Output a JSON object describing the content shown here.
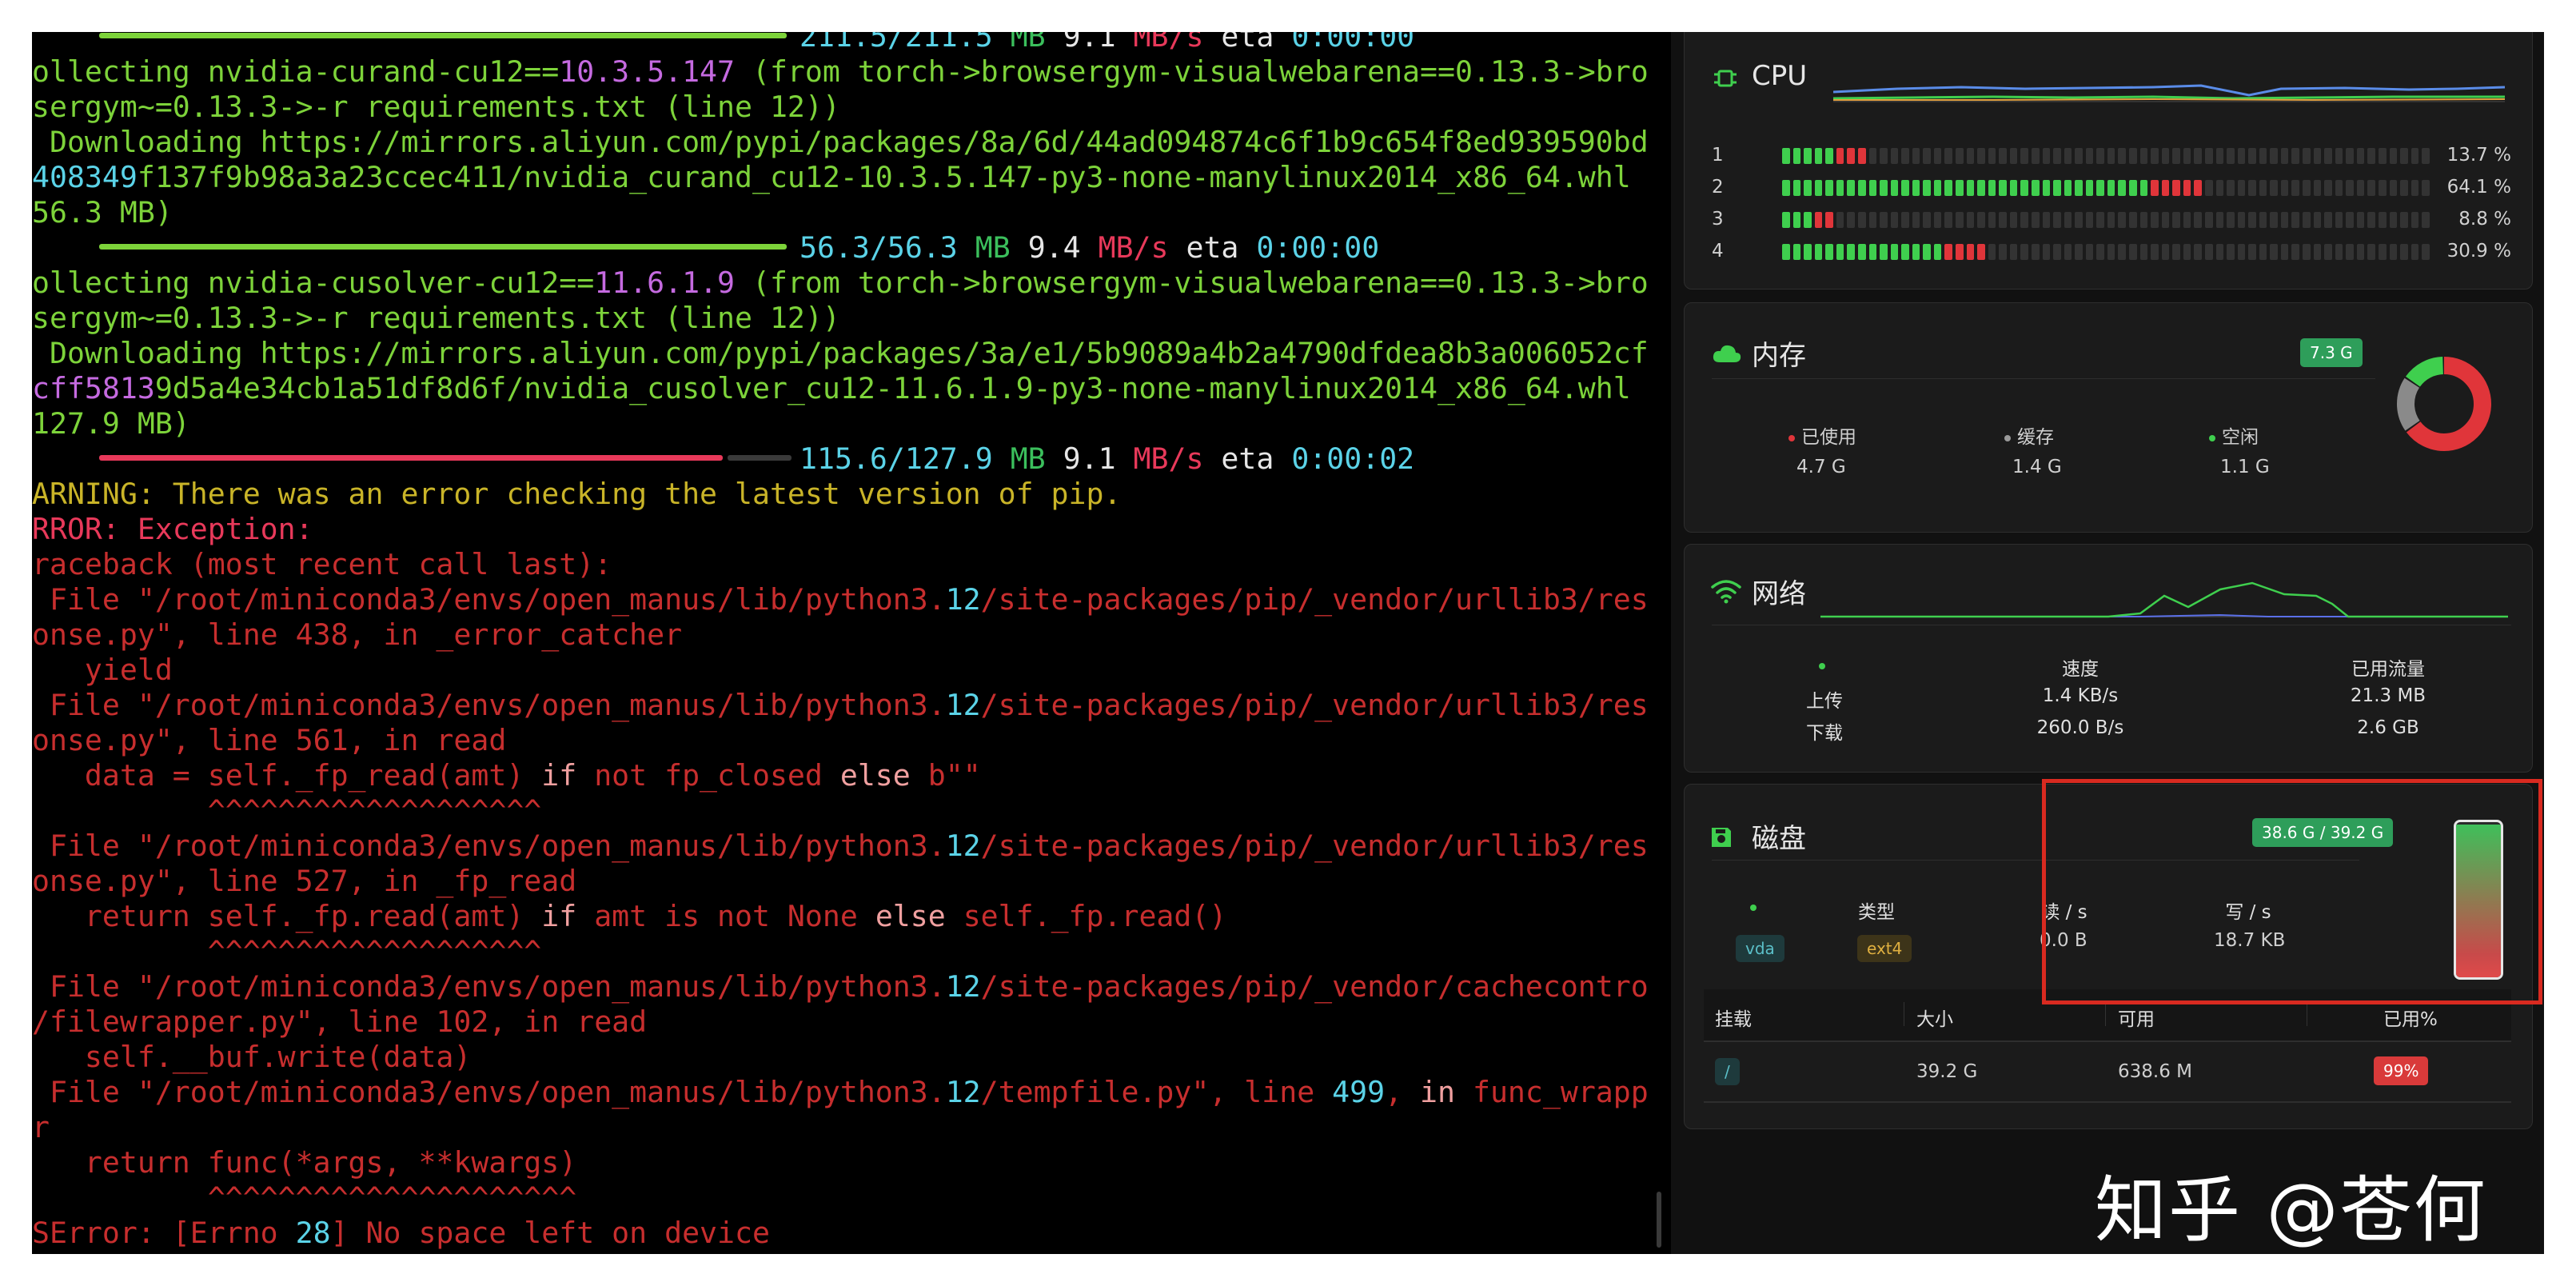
{
  "terminal": {
    "lines": [
      {
        "kind": "progress_top",
        "parts": [
          {
            "t": "211.5/211.5",
            "c": "c"
          },
          {
            "t": " MB",
            "c": "gd"
          },
          {
            "t": " 9.1",
            "c": "w"
          },
          {
            "t": " MB/s",
            "c": "r"
          },
          {
            "t": " eta ",
            "c": "w"
          },
          {
            "t": "0:00:00",
            "c": "c"
          }
        ]
      },
      {
        "parts": [
          {
            "t": "ollecting nvidia-curand-cu12==",
            "c": "g"
          },
          {
            "t": "10.3.5.147",
            "c": "m"
          },
          {
            "t": " (from torch->browsergym-visualwebarena==0.13.3->bro",
            "c": "g"
          }
        ]
      },
      {
        "parts": [
          {
            "t": "sergym~=0.13.3->-r requirements.txt (line 12))",
            "c": "g"
          }
        ]
      },
      {
        "parts": [
          {
            "t": " Downloading https://mirrors.aliyun.com/pypi/packages/8a/6d/44ad094874c6f1b9c654f8ed939590bd",
            "c": "g"
          }
        ]
      },
      {
        "parts": [
          {
            "t": "408349",
            "c": "c"
          },
          {
            "t": "f137f9b98a3a23ccec411/nvidia_curand_cu12-10.3.5.147-py3-none-manylinux2014_x86_64.whl",
            "c": "g"
          }
        ]
      },
      {
        "parts": [
          {
            "t": "56.3 MB)",
            "c": "g"
          }
        ]
      },
      {
        "kind": "progress",
        "bar": [
          [
            "#7dd33a",
            860
          ]
        ],
        "parts": [
          {
            "t": "56.3",
            "c": "c"
          },
          {
            "t": "/56.3",
            "c": "c"
          },
          {
            "t": " MB",
            "c": "gd"
          },
          {
            "t": " 9.4",
            "c": "w"
          },
          {
            "t": " MB/s",
            "c": "r"
          },
          {
            "t": " eta ",
            "c": "w"
          },
          {
            "t": "0:00:00",
            "c": "c"
          }
        ]
      },
      {
        "parts": [
          {
            "t": "ollecting nvidia-cusolver-cu12==",
            "c": "g"
          },
          {
            "t": "11.6.1.9",
            "c": "m"
          },
          {
            "t": " (from torch->browsergym-visualwebarena==0.13.3->bro",
            "c": "g"
          }
        ]
      },
      {
        "parts": [
          {
            "t": "sergym~=0.13.3->-r requirements.txt (line 12))",
            "c": "g"
          }
        ]
      },
      {
        "parts": [
          {
            "t": " Downloading https://mirrors.aliyun.com/pypi/packages/3a/e1/5b9089a4b2a4790dfdea8b3a006052cf",
            "c": "g"
          }
        ]
      },
      {
        "parts": [
          {
            "t": "cff5813",
            "c": "m"
          },
          {
            "t": "9d5a4e34cb1a51df8d6f/nvidia_cusolver_cu12-11.6.1.9-py3-none-manylinux2014_x86_64.whl",
            "c": "g"
          }
        ]
      },
      {
        "parts": [
          {
            "t": "127.9 MB)",
            "c": "g"
          }
        ]
      },
      {
        "kind": "progress",
        "bar": [
          [
            "#e8395a",
            780
          ],
          [
            "#3a3a3a",
            80
          ]
        ],
        "parts": [
          {
            "t": "115.6",
            "c": "c"
          },
          {
            "t": "/127.9",
            "c": "c"
          },
          {
            "t": " MB",
            "c": "gd"
          },
          {
            "t": " 9.1",
            "c": "w"
          },
          {
            "t": " MB/s",
            "c": "r"
          },
          {
            "t": " eta ",
            "c": "w"
          },
          {
            "t": "0:00:02",
            "c": "c"
          }
        ]
      },
      {
        "parts": [
          {
            "t": "ARNING: There was an error checking the latest version of pip.",
            "c": "y"
          }
        ]
      },
      {
        "parts": [
          {
            "t": "RROR: Exception:",
            "c": "r"
          }
        ]
      },
      {
        "parts": [
          {
            "t": "raceback (most recent call last):",
            "c": "o"
          }
        ]
      },
      {
        "parts": [
          {
            "t": " File \"/root/miniconda3/envs/open_manus/lib/python3.",
            "c": "o"
          },
          {
            "t": "12",
            "c": "c"
          },
          {
            "t": "/site-packages/pip/_vendor/urllib3/res",
            "c": "o"
          }
        ]
      },
      {
        "parts": [
          {
            "t": "onse.py\", line 438, in _error_catcher",
            "c": "o"
          }
        ]
      },
      {
        "parts": [
          {
            "t": "   yield",
            "c": "o"
          }
        ]
      },
      {
        "parts": [
          {
            "t": " File \"/root/miniconda3/envs/open_manus/lib/python3.",
            "c": "o"
          },
          {
            "t": "12",
            "c": "c"
          },
          {
            "t": "/site-packages/pip/_vendor/urllib3/res",
            "c": "o"
          }
        ]
      },
      {
        "parts": [
          {
            "t": "onse.py\", line 561, in read",
            "c": "o"
          }
        ]
      },
      {
        "parts": [
          {
            "t": "   data = self._fp_read(amt) ",
            "c": "o"
          },
          {
            "t": "if",
            "c": "p"
          },
          {
            "t": " not fp_closed ",
            "c": "o"
          },
          {
            "t": "else",
            "c": "p"
          },
          {
            "t": " b\"\"",
            "c": "o"
          }
        ]
      },
      {
        "parts": [
          {
            "t": "          ^^^^^^^^^^^^^^^^^^^",
            "c": "o"
          }
        ]
      },
      {
        "parts": [
          {
            "t": " File \"/root/miniconda3/envs/open_manus/lib/python3.",
            "c": "o"
          },
          {
            "t": "12",
            "c": "c"
          },
          {
            "t": "/site-packages/pip/_vendor/urllib3/res",
            "c": "o"
          }
        ]
      },
      {
        "parts": [
          {
            "t": "onse.py\", line 527, in _fp_read",
            "c": "o"
          }
        ]
      },
      {
        "parts": [
          {
            "t": "   return self._fp.read(amt) ",
            "c": "o"
          },
          {
            "t": "if",
            "c": "p"
          },
          {
            "t": " amt is not None ",
            "c": "o"
          },
          {
            "t": "else",
            "c": "p"
          },
          {
            "t": " self._fp.read()",
            "c": "o"
          }
        ]
      },
      {
        "parts": [
          {
            "t": "          ^^^^^^^^^^^^^^^^^^^",
            "c": "o"
          }
        ]
      },
      {
        "parts": [
          {
            "t": " File \"/root/miniconda3/envs/open_manus/lib/python3.",
            "c": "o"
          },
          {
            "t": "12",
            "c": "c"
          },
          {
            "t": "/site-packages/pip/_vendor/cachecontro",
            "c": "o"
          }
        ]
      },
      {
        "parts": [
          {
            "t": "/filewrapper.py\", line 102, in read",
            "c": "o"
          }
        ]
      },
      {
        "parts": [
          {
            "t": "   self.__buf.write(data)",
            "c": "o"
          }
        ]
      },
      {
        "parts": [
          {
            "t": " File \"/root/miniconda3/envs/open_manus/lib/python3.",
            "c": "o"
          },
          {
            "t": "12",
            "c": "c"
          },
          {
            "t": "/tempfile.py\", line ",
            "c": "o"
          },
          {
            "t": "499",
            "c": "c"
          },
          {
            "t": ", ",
            "c": "o"
          },
          {
            "t": "in",
            "c": "p"
          },
          {
            "t": " func_wrapp",
            "c": "o"
          }
        ]
      },
      {
        "parts": [
          {
            "t": "r",
            "c": "o"
          }
        ]
      },
      {
        "parts": [
          {
            "t": "   return func(*args, **kwargs)",
            "c": "o"
          }
        ]
      },
      {
        "parts": [
          {
            "t": "          ^^^^^^^^^^^^^^^^^^^^^",
            "c": "o"
          }
        ]
      },
      {
        "parts": [
          {
            "t": "SError: [Errno ",
            "c": "o"
          },
          {
            "t": "28",
            "c": "c"
          },
          {
            "t": "] No space left on device",
            "c": "o"
          }
        ]
      }
    ]
  },
  "cpu": {
    "title": "CPU",
    "icon": "cpu-icon",
    "cores": [
      {
        "id": "1",
        "pct": "13.7 %",
        "green": 5,
        "red": 3
      },
      {
        "id": "2",
        "pct": "64.1 %",
        "green": 34,
        "red": 5
      },
      {
        "id": "3",
        "pct": "8.8 %",
        "green": 3,
        "red": 2
      },
      {
        "id": "4",
        "pct": "30.9 %",
        "green": 15,
        "red": 4
      }
    ],
    "segments_total": 60
  },
  "memory": {
    "title": "内存",
    "icon": "cloud-icon",
    "badge": "7.3 G",
    "used_label": "已使用",
    "used_value": "4.7 G",
    "cache_label": "缓存",
    "cache_value": "1.4 G",
    "free_label": "空闲",
    "free_value": "1.1 G",
    "donut": {
      "used": 4.7,
      "cache": 1.4,
      "free": 1.1
    }
  },
  "network": {
    "title": "网络",
    "icon": "wifi-icon",
    "col_speed": "速度",
    "col_total": "已用流量",
    "rows": [
      {
        "label": "上传",
        "speed": "1.4 KB/s",
        "total": "21.3 MB"
      },
      {
        "label": "下载",
        "speed": "260.0 B/s",
        "total": "2.6 GB"
      }
    ]
  },
  "disk": {
    "title": "磁盘",
    "icon": "disk-icon",
    "badge": "38.6 G / 39.2 G",
    "usage_fraction": 0.985,
    "device": "vda",
    "type_label": "类型",
    "type_value": "ext4",
    "read_label": "读 / s",
    "read_value": "0.0 B",
    "write_label": "写 / s",
    "write_value": "18.7 KB",
    "table": {
      "headers": [
        "挂载",
        "大小",
        "可用",
        "已用%"
      ],
      "rows": [
        {
          "mount": "/",
          "size": "39.2 G",
          "avail": "638.6 M",
          "used": "99%"
        }
      ]
    }
  },
  "colors": {
    "green": "#3fcf4e",
    "red": "#e0353a",
    "badge_green": "#2e9e5a",
    "annotation": "#d92a20"
  },
  "watermark": "知乎 @苍何"
}
